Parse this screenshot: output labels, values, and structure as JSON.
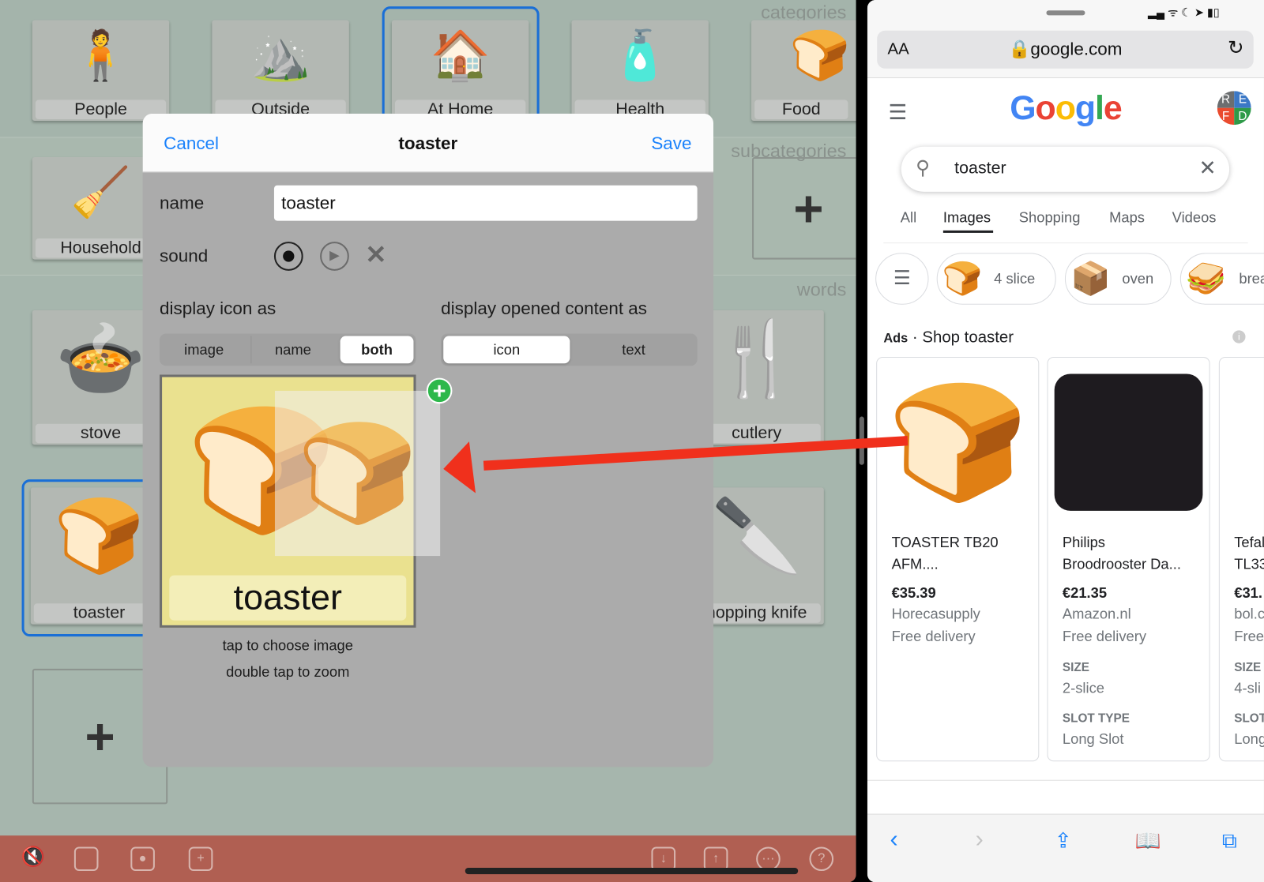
{
  "left_app": {
    "sections": {
      "categories": "categories",
      "subcategories": "subcategories",
      "words": "words"
    },
    "categories": [
      {
        "label": "People",
        "icon": "person-icon"
      },
      {
        "label": "Outside",
        "icon": "landscape-icon"
      },
      {
        "label": "At Home",
        "icon": "house-icon",
        "selected": true
      },
      {
        "label": "Health",
        "icon": "medicine-bottle-icon"
      },
      {
        "label": "Food",
        "icon": "bread-icon"
      }
    ],
    "subcategories": [
      {
        "label": "Household",
        "icon": "broom-icon"
      }
    ],
    "words": [
      {
        "label": "stove",
        "icon": "stove-icon"
      },
      {
        "label": "cutlery",
        "icon": "cutlery-icon"
      },
      {
        "label": "toaster",
        "icon": "toaster-icon",
        "selected": true
      },
      {
        "label": "hopping knife",
        "icon": "knife-icon"
      }
    ],
    "bottom_bar_icons": [
      "mute-icon",
      "speech-bubble-icon",
      "contact-icon",
      "add-icon",
      "import-icon",
      "share-icon",
      "more-icon",
      "help-icon"
    ]
  },
  "dialog": {
    "cancel": "Cancel",
    "title": "toaster",
    "save": "Save",
    "name_label": "name",
    "name_value": "toaster",
    "sound_label": "sound",
    "display_icon_label": "display icon as",
    "display_icon_options": [
      "image",
      "name",
      "both"
    ],
    "display_icon_selected": "both",
    "display_content_label": "display opened content as",
    "display_content_options": [
      "icon",
      "text"
    ],
    "display_content_selected": "icon",
    "preview_label": "toaster",
    "hint1": "tap to choose image",
    "hint2": "double tap to zoom"
  },
  "browser": {
    "aa": "AA",
    "url": "google.com",
    "logo": "Google",
    "avatar": [
      "R",
      "E",
      "F",
      "D"
    ],
    "search_value": "toaster",
    "tabs": [
      "All",
      "Images",
      "Shopping",
      "Maps",
      "Videos"
    ],
    "active_tab": "Images",
    "chips": [
      "4 slice",
      "oven",
      "brea"
    ],
    "ads_label": "Ads",
    "ads_title": "Shop toaster",
    "products": [
      {
        "title1": "TOASTER TB20",
        "title2": "AFM....",
        "price": "€35.39",
        "store": "Horecasupply",
        "delivery": "Free delivery"
      },
      {
        "title1": "Philips",
        "title2": "Broodrooster Da...",
        "price": "€21.35",
        "store": "Amazon.nl",
        "delivery": "Free delivery",
        "size_label": "SIZE",
        "size": "2-slice",
        "slot_label": "SLOT TYPE",
        "slot": "Long Slot"
      },
      {
        "title1": "Tefal",
        "title2": "TL33",
        "price": "€31.",
        "store": "bol.c",
        "delivery": "Free",
        "size_label": "SIZE",
        "size": "4-sli",
        "slot_label": "SLOT",
        "slot": "Long"
      }
    ]
  },
  "colors": {
    "accent": "#1a82fb",
    "selection": "#1a6fd6",
    "bottom_bar": "#b05f52",
    "arrow": "#f0301c"
  }
}
